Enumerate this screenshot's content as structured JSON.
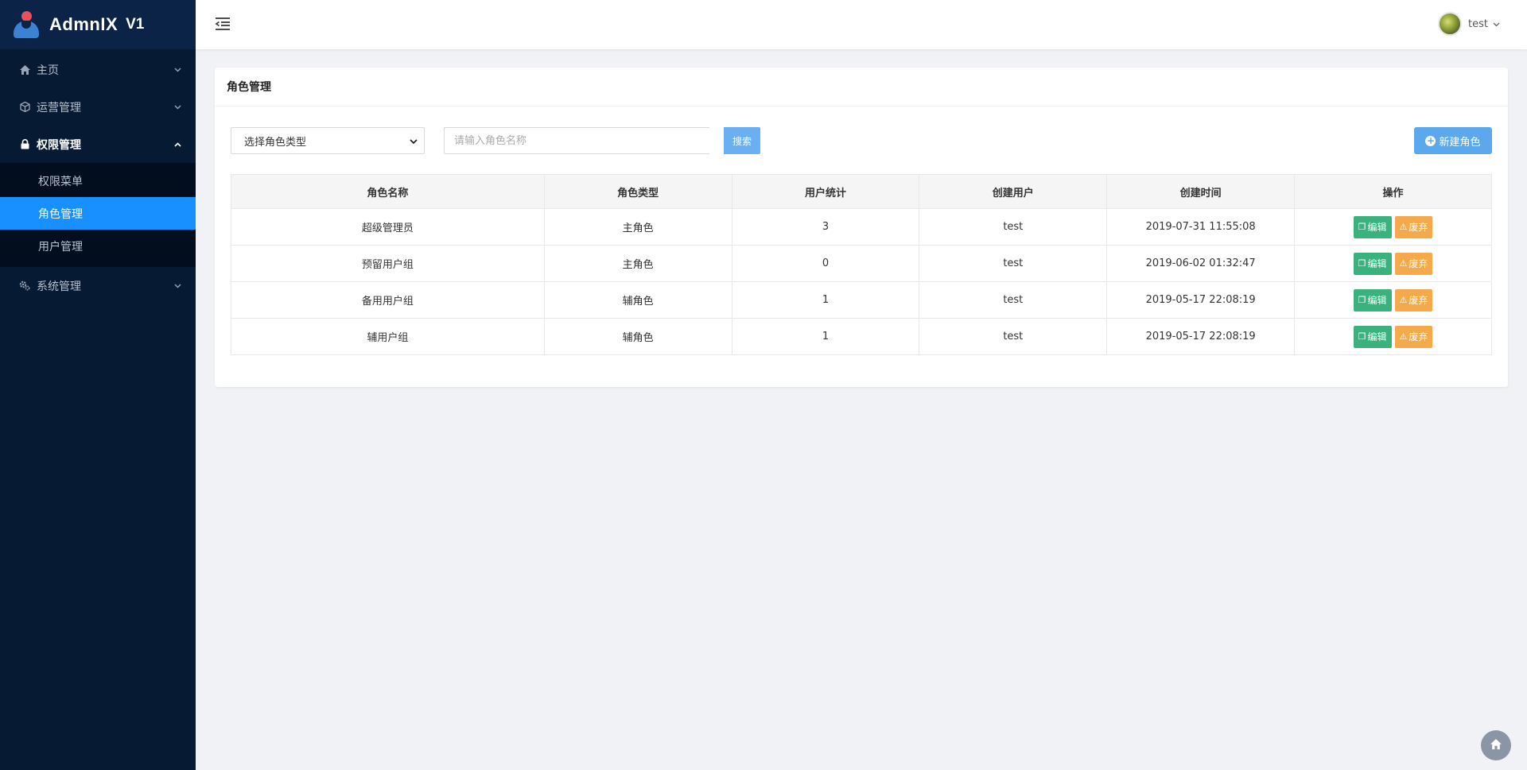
{
  "brand": {
    "name": "AdmnIX",
    "version": "V1"
  },
  "sidebar": {
    "items": [
      {
        "label": "主页",
        "icon": "home-icon"
      },
      {
        "label": "运营管理",
        "icon": "cube-icon"
      },
      {
        "label": "权限管理",
        "icon": "lock-icon",
        "open": true,
        "children": [
          {
            "label": "权限菜单"
          },
          {
            "label": "角色管理",
            "active": true
          },
          {
            "label": "用户管理"
          }
        ]
      },
      {
        "label": "系统管理",
        "icon": "gears-icon"
      }
    ]
  },
  "header": {
    "username": "test"
  },
  "card": {
    "title": "角色管理",
    "select_placeholder": "选择角色类型",
    "search_placeholder": "请输入角色名称",
    "search_label": "搜索",
    "new_label": "新建角色"
  },
  "table": {
    "columns": [
      "角色名称",
      "角色类型",
      "用户统计",
      "创建用户",
      "创建时间",
      "操作"
    ],
    "rows": [
      [
        "超级管理员",
        "主角色",
        "3",
        "test",
        "2019-07-31 11:55:08"
      ],
      [
        "预留用户组",
        "主角色",
        "0",
        "test",
        "2019-06-02 01:32:47"
      ],
      [
        "备用用户组",
        "辅角色",
        "1",
        "test",
        "2019-05-17 22:08:19"
      ],
      [
        "辅用户组",
        "辅角色",
        "1",
        "test",
        "2019-05-17 22:08:19"
      ]
    ],
    "edit_label": "编辑",
    "delete_label": "废弃"
  },
  "colors": {
    "sidebar": "#071a33",
    "active": "#1890ff",
    "edit": "#39b27d",
    "delete": "#f4a94a",
    "primary": "#5ba8ec"
  }
}
